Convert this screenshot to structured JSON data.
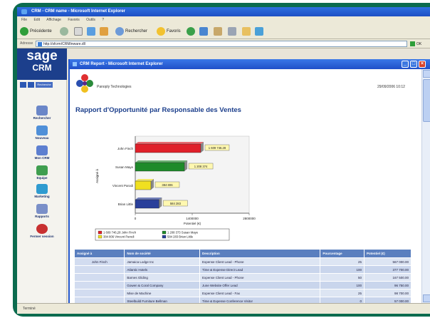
{
  "outer_window": {
    "title": "CRM - CRM name - Microsoft Internet Explorer",
    "menu": [
      "File",
      "Edit",
      "Affichage",
      "Favoris",
      "Outils",
      "?"
    ],
    "toolbar": {
      "back_label": "Précédente",
      "search_label": "Rechercher",
      "favorites_label": "Favoris"
    },
    "address_label": "Adresse",
    "address_value": "http://sfcrm/CRM/eware.dll",
    "go_label": "OK",
    "status_text": "Terminé"
  },
  "sidebar": {
    "logo_line1": "sage",
    "logo_line2": "CRM",
    "quick_label": "Recherche",
    "items": [
      {
        "label": "Rechercher",
        "icon": "magnifier-icon",
        "color": "#6a86c8"
      },
      {
        "label": "Nouveau",
        "icon": "new-document-icon",
        "color": "#4f8fd8"
      },
      {
        "label": "Mon CRM",
        "icon": "my-crm-icon",
        "color": "#5d7fd0"
      },
      {
        "label": "Equipe",
        "icon": "team-icon",
        "color": "#3f9e4f"
      },
      {
        "label": "Marketing",
        "icon": "marketing-icon",
        "color": "#2f9bd0"
      },
      {
        "label": "Rapports",
        "icon": "reports-icon",
        "color": "#7a8fc8"
      },
      {
        "label": "Fermer session",
        "icon": "logout-icon",
        "color": "#c83030"
      }
    ]
  },
  "popup": {
    "title": "CRM Report - Microsoft Internet Explorer",
    "company": "Panoply Technologies",
    "date": "29/09/2006 10:12",
    "report_title": "Rapport d'Opportunité par Responsable des Ventes"
  },
  "chart_data": {
    "type": "bar",
    "orientation": "horizontal",
    "categories": [
      "John Finch",
      "Susan Maye",
      "Vincent Parodi",
      "Brian Little"
    ],
    "values": [
      1609746,
      1208374,
      384806,
      584283
    ],
    "data_labels": [
      "1 609 746.28",
      "1 208 374",
      "384 806",
      "584 283"
    ],
    "colors": [
      "#e0202a",
      "#1e8a2a",
      "#f0e020",
      "#2a3f9a"
    ],
    "xlabel": "Potentiel (€)",
    "ylabel": "Assigné à",
    "xticks": [
      "0",
      "1400000",
      "2800000"
    ],
    "xlim": [
      0,
      2800000
    ],
    "legend": [
      "1 609 746,28 John Finch",
      "1 208 373 Susan Maye",
      "384 806 Vincent Parodi",
      "584 283 Brian Little"
    ],
    "legend_placement": "bottom"
  },
  "table": {
    "headers": [
      "Assigné à",
      "Nom de société",
      "Description",
      "Pourcentage",
      "Potentiel (€)"
    ],
    "rows": [
      [
        "John Finch",
        "Jamaica Lodge Inc",
        "Expense Client Lead - Phone",
        "25",
        "567 000.00"
      ],
      [
        "",
        "Atlantic Hotels",
        "Time & Expense Direct Lead",
        "100",
        "377 700.00"
      ],
      [
        "",
        "Barnes Gliding",
        "Expense Client Lead - Phone",
        "50",
        "167 500.00"
      ],
      [
        "",
        "Gowen & Coral Company",
        "June Website Offer Lead",
        "100",
        "96 750.00"
      ],
      [
        "",
        "Mise de Machine",
        "Expense Client Lead - Fax",
        "25",
        "98 700.00"
      ],
      [
        "",
        "Steelbuild Furniture Bellman",
        "Time & Expense Conference Visitor",
        "0",
        "57 000.00"
      ]
    ]
  }
}
